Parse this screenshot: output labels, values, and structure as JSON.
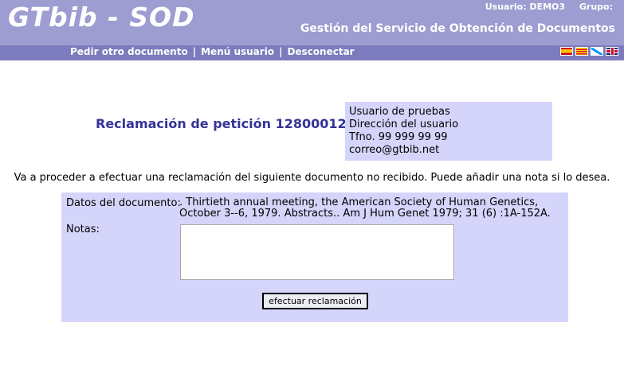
{
  "header": {
    "logo": "GTbib - SOD",
    "user_label": "Usuario: DEMO3",
    "group_label": "Grupo:",
    "subtitle": "Gestión del Servicio de Obtención de Documentos"
  },
  "nav": {
    "items": [
      "Pedir otro documento",
      "Menú usuario",
      "Desconectar"
    ],
    "separator": "|"
  },
  "languages": [
    "es",
    "ca",
    "gl",
    "en"
  ],
  "page": {
    "title": "Reclamación de petición 12800012",
    "user": {
      "name": "Usuario de pruebas",
      "address": "Dirección del usuario",
      "phone": "Tfno. 99 999 99 99",
      "email": "correo@gtbib.net"
    },
    "intro": "Va a proceder a efectuar una reclamación del siguiente documento no recibido. Puede añadir una nota si lo desea."
  },
  "form": {
    "doc_label": "Datos del documento:",
    "doc_value": ". Thirtieth annual meeting, the American Society of Human Genetics, October 3--6, 1979. Abstracts.. Am J Hum Genet 1979; 31 (6) :1A-152A.",
    "notes_label": "Notas:",
    "notes_value": "",
    "submit_label": "efectuar  reclamación"
  },
  "colors": {
    "header_bg": "#9d9dd1",
    "nav_bg": "#7b7bbd",
    "panel_bg": "#d5d5fb",
    "title": "#333399"
  }
}
